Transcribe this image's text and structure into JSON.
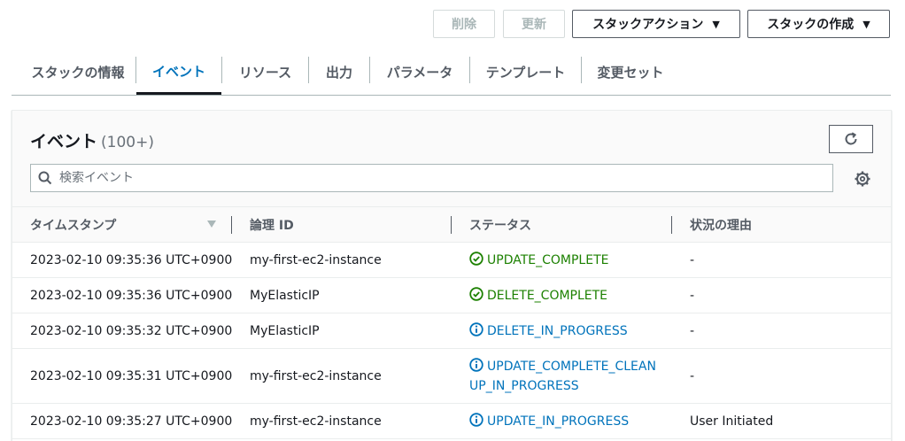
{
  "actions": {
    "delete_label": "削除",
    "update_label": "更新",
    "stack_actions_label": "スタックアクション",
    "create_stack_label": "スタックの作成"
  },
  "tabs": [
    {
      "label": "スタックの情報"
    },
    {
      "label": "イベント"
    },
    {
      "label": "リソース"
    },
    {
      "label": "出力"
    },
    {
      "label": "パラメータ"
    },
    {
      "label": "テンプレート"
    },
    {
      "label": "変更セット"
    }
  ],
  "panel": {
    "title": "イベント",
    "count": "(100+)",
    "search_placeholder": "検索イベント"
  },
  "table": {
    "columns": [
      "タイムスタンプ",
      "論理 ID",
      "ステータス",
      "状況の理由"
    ],
    "rows": [
      {
        "timestamp": "2023-02-10 09:35:36 UTC+0900",
        "logical_id": "my-first-ec2-instance",
        "status_line1": "UPDATE_COMPLETE",
        "status_line2": "",
        "status_type": "complete",
        "reason": "-"
      },
      {
        "timestamp": "2023-02-10 09:35:36 UTC+0900",
        "logical_id": "MyElasticIP",
        "status_line1": "DELETE_COMPLETE",
        "status_line2": "",
        "status_type": "complete",
        "reason": "-"
      },
      {
        "timestamp": "2023-02-10 09:35:32 UTC+0900",
        "logical_id": "MyElasticIP",
        "status_line1": "DELETE_IN_PROGRESS",
        "status_line2": "",
        "status_type": "progress",
        "reason": "-"
      },
      {
        "timestamp": "2023-02-10 09:35:31 UTC+0900",
        "logical_id": "my-first-ec2-instance",
        "status_line1": "UPDATE_COMPLETE_CLEAN",
        "status_line2": "UP_IN_PROGRESS",
        "status_type": "progress",
        "reason": "-"
      },
      {
        "timestamp": "2023-02-10 09:35:27 UTC+0900",
        "logical_id": "my-first-ec2-instance",
        "status_line1": "UPDATE_IN_PROGRESS",
        "status_line2": "",
        "status_type": "progress",
        "reason": "User Initiated"
      }
    ]
  },
  "colors": {
    "accent": "#0073bb",
    "success": "#1d8102",
    "border": "#aab7b8"
  },
  "icons": {
    "success": "check-circle-icon",
    "info": "info-circle-icon",
    "search": "search-icon",
    "refresh": "refresh-icon",
    "settings": "gear-icon"
  }
}
